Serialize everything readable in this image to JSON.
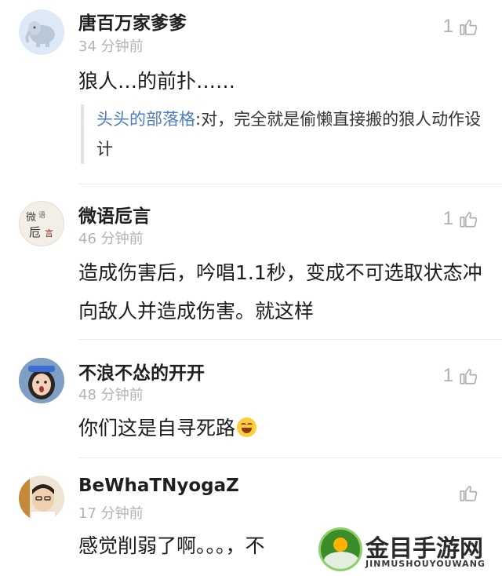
{
  "comments": [
    {
      "username": "唐百万家爹爹",
      "time": "34 分钟前",
      "likes": "1",
      "text": "狼人…的前扑……",
      "quote": {
        "author": "头头的部落格",
        "text": ":对，完全就是偷懒直接搬的狼人动作设计"
      },
      "avatar": "elephant-avatar"
    },
    {
      "username": "微语卮言",
      "time": "46 分钟前",
      "likes": "1",
      "text": "造成伤害后，吟唱1.1秒，变成不可选取状态冲向敌人并造成伤害。就这样",
      "avatar": "calligraphy-avatar"
    },
    {
      "username": "不浪不怂的开开",
      "time": "48 分钟前",
      "likes": "1",
      "text": "你们这是自寻死路",
      "emoji": "laughing-tears-emoji",
      "avatar": "girl-avatar"
    },
    {
      "username": "BeWhaTNyogaZ",
      "time": "17 分钟前",
      "likes": "",
      "text": "感觉削弱了啊。。。，不",
      "avatar": "boy-avatar"
    }
  ],
  "watermark": {
    "title": "金目手游网",
    "subtitle": "JINMUSHOUYOUWANG"
  },
  "icons": {
    "like": "thumbs-up-icon"
  }
}
